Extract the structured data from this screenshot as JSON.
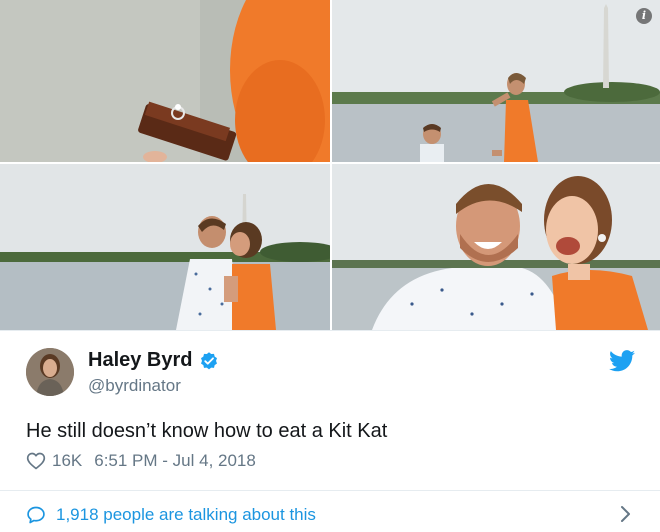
{
  "photos": [
    {
      "name": "photo-kitkat-ring"
    },
    {
      "name": "photo-proposal-monument"
    },
    {
      "name": "photo-kiss"
    },
    {
      "name": "photo-couple-smiling"
    }
  ],
  "tweet": {
    "display_name": "Haley Byrd",
    "handle": "@byrdinator",
    "text": "He still doesn’t know how to eat a Kit Kat",
    "like_count": "16K",
    "timestamp": "6:51 PM - Jul 4, 2018"
  },
  "conversation": {
    "label": "1,918 people are talking about this"
  },
  "colors": {
    "twitter_blue": "#1da1f2",
    "link_blue": "#1b95e0",
    "secondary_text": "#657786"
  }
}
